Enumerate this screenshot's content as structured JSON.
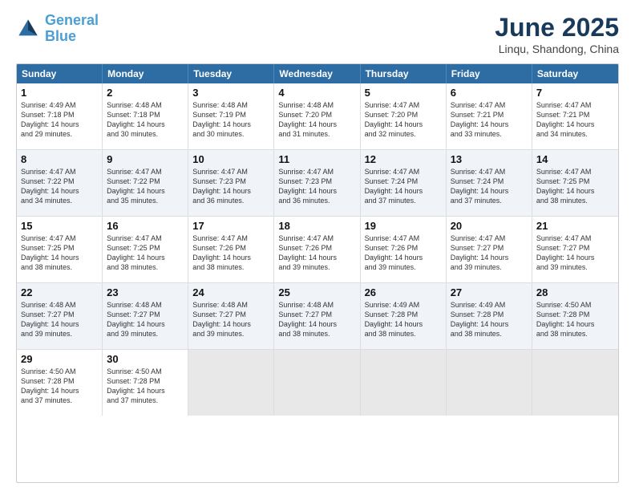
{
  "header": {
    "logo_line1": "General",
    "logo_line2": "Blue",
    "main_title": "June 2025",
    "subtitle": "Linqu, Shandong, China"
  },
  "calendar": {
    "days_of_week": [
      "Sunday",
      "Monday",
      "Tuesday",
      "Wednesday",
      "Thursday",
      "Friday",
      "Saturday"
    ],
    "rows": [
      [
        {
          "day": "1",
          "lines": [
            "Sunrise: 4:49 AM",
            "Sunset: 7:18 PM",
            "Daylight: 14 hours",
            "and 29 minutes."
          ]
        },
        {
          "day": "2",
          "lines": [
            "Sunrise: 4:48 AM",
            "Sunset: 7:18 PM",
            "Daylight: 14 hours",
            "and 30 minutes."
          ]
        },
        {
          "day": "3",
          "lines": [
            "Sunrise: 4:48 AM",
            "Sunset: 7:19 PM",
            "Daylight: 14 hours",
            "and 30 minutes."
          ]
        },
        {
          "day": "4",
          "lines": [
            "Sunrise: 4:48 AM",
            "Sunset: 7:20 PM",
            "Daylight: 14 hours",
            "and 31 minutes."
          ]
        },
        {
          "day": "5",
          "lines": [
            "Sunrise: 4:47 AM",
            "Sunset: 7:20 PM",
            "Daylight: 14 hours",
            "and 32 minutes."
          ]
        },
        {
          "day": "6",
          "lines": [
            "Sunrise: 4:47 AM",
            "Sunset: 7:21 PM",
            "Daylight: 14 hours",
            "and 33 minutes."
          ]
        },
        {
          "day": "7",
          "lines": [
            "Sunrise: 4:47 AM",
            "Sunset: 7:21 PM",
            "Daylight: 14 hours",
            "and 34 minutes."
          ]
        }
      ],
      [
        {
          "day": "8",
          "lines": [
            "Sunrise: 4:47 AM",
            "Sunset: 7:22 PM",
            "Daylight: 14 hours",
            "and 34 minutes."
          ]
        },
        {
          "day": "9",
          "lines": [
            "Sunrise: 4:47 AM",
            "Sunset: 7:22 PM",
            "Daylight: 14 hours",
            "and 35 minutes."
          ]
        },
        {
          "day": "10",
          "lines": [
            "Sunrise: 4:47 AM",
            "Sunset: 7:23 PM",
            "Daylight: 14 hours",
            "and 36 minutes."
          ]
        },
        {
          "day": "11",
          "lines": [
            "Sunrise: 4:47 AM",
            "Sunset: 7:23 PM",
            "Daylight: 14 hours",
            "and 36 minutes."
          ]
        },
        {
          "day": "12",
          "lines": [
            "Sunrise: 4:47 AM",
            "Sunset: 7:24 PM",
            "Daylight: 14 hours",
            "and 37 minutes."
          ]
        },
        {
          "day": "13",
          "lines": [
            "Sunrise: 4:47 AM",
            "Sunset: 7:24 PM",
            "Daylight: 14 hours",
            "and 37 minutes."
          ]
        },
        {
          "day": "14",
          "lines": [
            "Sunrise: 4:47 AM",
            "Sunset: 7:25 PM",
            "Daylight: 14 hours",
            "and 38 minutes."
          ]
        }
      ],
      [
        {
          "day": "15",
          "lines": [
            "Sunrise: 4:47 AM",
            "Sunset: 7:25 PM",
            "Daylight: 14 hours",
            "and 38 minutes."
          ]
        },
        {
          "day": "16",
          "lines": [
            "Sunrise: 4:47 AM",
            "Sunset: 7:25 PM",
            "Daylight: 14 hours",
            "and 38 minutes."
          ]
        },
        {
          "day": "17",
          "lines": [
            "Sunrise: 4:47 AM",
            "Sunset: 7:26 PM",
            "Daylight: 14 hours",
            "and 38 minutes."
          ]
        },
        {
          "day": "18",
          "lines": [
            "Sunrise: 4:47 AM",
            "Sunset: 7:26 PM",
            "Daylight: 14 hours",
            "and 39 minutes."
          ]
        },
        {
          "day": "19",
          "lines": [
            "Sunrise: 4:47 AM",
            "Sunset: 7:26 PM",
            "Daylight: 14 hours",
            "and 39 minutes."
          ]
        },
        {
          "day": "20",
          "lines": [
            "Sunrise: 4:47 AM",
            "Sunset: 7:27 PM",
            "Daylight: 14 hours",
            "and 39 minutes."
          ]
        },
        {
          "day": "21",
          "lines": [
            "Sunrise: 4:47 AM",
            "Sunset: 7:27 PM",
            "Daylight: 14 hours",
            "and 39 minutes."
          ]
        }
      ],
      [
        {
          "day": "22",
          "lines": [
            "Sunrise: 4:48 AM",
            "Sunset: 7:27 PM",
            "Daylight: 14 hours",
            "and 39 minutes."
          ]
        },
        {
          "day": "23",
          "lines": [
            "Sunrise: 4:48 AM",
            "Sunset: 7:27 PM",
            "Daylight: 14 hours",
            "and 39 minutes."
          ]
        },
        {
          "day": "24",
          "lines": [
            "Sunrise: 4:48 AM",
            "Sunset: 7:27 PM",
            "Daylight: 14 hours",
            "and 39 minutes."
          ]
        },
        {
          "day": "25",
          "lines": [
            "Sunrise: 4:48 AM",
            "Sunset: 7:27 PM",
            "Daylight: 14 hours",
            "and 38 minutes."
          ]
        },
        {
          "day": "26",
          "lines": [
            "Sunrise: 4:49 AM",
            "Sunset: 7:28 PM",
            "Daylight: 14 hours",
            "and 38 minutes."
          ]
        },
        {
          "day": "27",
          "lines": [
            "Sunrise: 4:49 AM",
            "Sunset: 7:28 PM",
            "Daylight: 14 hours",
            "and 38 minutes."
          ]
        },
        {
          "day": "28",
          "lines": [
            "Sunrise: 4:50 AM",
            "Sunset: 7:28 PM",
            "Daylight: 14 hours",
            "and 38 minutes."
          ]
        }
      ],
      [
        {
          "day": "29",
          "lines": [
            "Sunrise: 4:50 AM",
            "Sunset: 7:28 PM",
            "Daylight: 14 hours",
            "and 37 minutes."
          ]
        },
        {
          "day": "30",
          "lines": [
            "Sunrise: 4:50 AM",
            "Sunset: 7:28 PM",
            "Daylight: 14 hours",
            "and 37 minutes."
          ]
        },
        {
          "day": "",
          "lines": []
        },
        {
          "day": "",
          "lines": []
        },
        {
          "day": "",
          "lines": []
        },
        {
          "day": "",
          "lines": []
        },
        {
          "day": "",
          "lines": []
        }
      ]
    ]
  }
}
